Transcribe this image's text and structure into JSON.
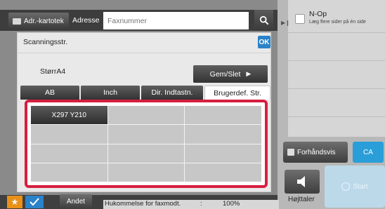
{
  "header": {
    "address_book_label": "Adr.-kartotek",
    "address_label": "Adresse",
    "fax_placeholder": "Faxnummer"
  },
  "right_panel": {
    "option_title": "N-Op",
    "option_subtitle": "Læg flere sider på én side",
    "preview_label": "Forhåndsvis",
    "ca_label": "CA",
    "speaker_label": "Højttaler",
    "start_label": "Start"
  },
  "bottom": {
    "other_label": "Andet",
    "memory_label": "Hukommelse for faxmodt.",
    "memory_sep": ":",
    "memory_value": "100%"
  },
  "dialog": {
    "title": "Scanningsstr.",
    "ok_label": "OK",
    "size_label": "StørrA4",
    "store_delete_label": "Gem/Slet",
    "tabs": [
      {
        "label": "AB",
        "active": false
      },
      {
        "label": "Inch",
        "active": false
      },
      {
        "label": "Dir. Indtastn.",
        "active": false
      },
      {
        "label": "Brugerdef. Str.",
        "active": true
      }
    ],
    "cells": [
      "X297 Y210",
      "",
      "",
      "",
      "",
      "",
      "",
      "",
      "",
      "",
      "",
      ""
    ]
  },
  "colors": {
    "accent_blue": "#2a82c8",
    "highlight_red": "#d61f40",
    "ca_blue": "#2a9ed8",
    "star_orange": "#e89018"
  }
}
